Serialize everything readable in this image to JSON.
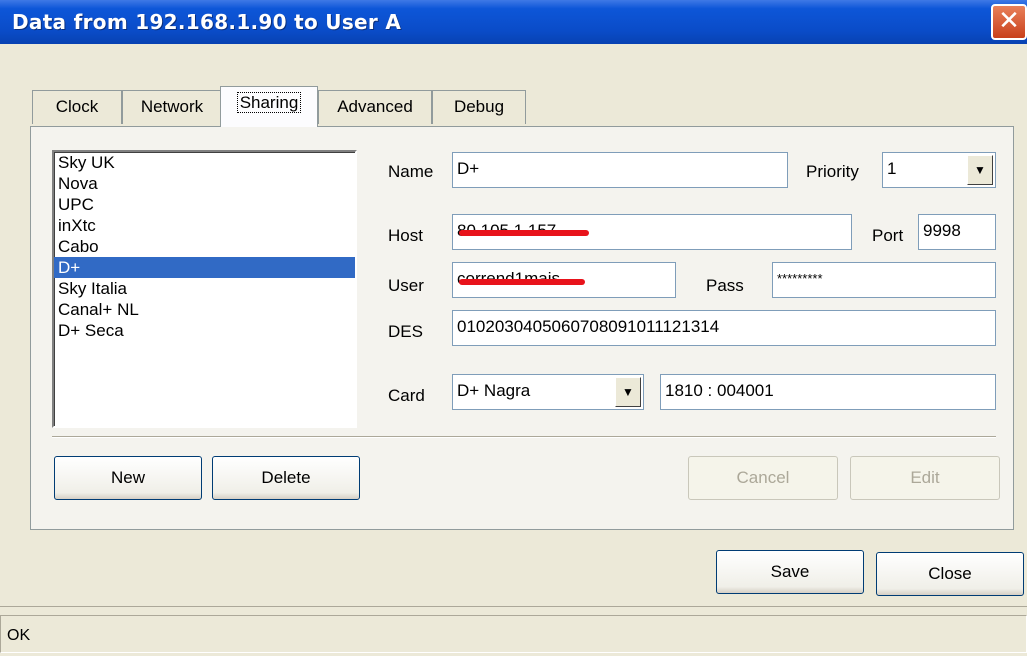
{
  "window": {
    "title": "Data from 192.168.1.90 to User A",
    "close_glyph": "✕"
  },
  "tabs": [
    {
      "label": "Clock"
    },
    {
      "label": "Network"
    },
    {
      "label": "Sharing"
    },
    {
      "label": "Advanced"
    },
    {
      "label": "Debug"
    }
  ],
  "providers": {
    "items": [
      "Sky UK",
      "Nova",
      "UPC",
      "inXtc",
      "Cabo",
      "D+",
      "Sky Italia",
      "Canal+ NL",
      "D+ Seca"
    ],
    "selected": "D+"
  },
  "form": {
    "name_label": "Name",
    "name_value": "D+",
    "priority_label": "Priority",
    "priority_value": "1",
    "host_label": "Host",
    "host_value": "80.105.1.157",
    "port_label": "Port",
    "port_value": "9998",
    "user_label": "User",
    "user_value": "corrend1mais",
    "pass_label": "Pass",
    "pass_value": "*********",
    "des_label": "DES",
    "des_value": "0102030405060708091011121314",
    "card_label": "Card",
    "card_value": "D+ Nagra",
    "caid_value": "1810 : 004001"
  },
  "buttons": {
    "new": "New",
    "delete": "Delete",
    "cancel": "Cancel",
    "edit": "Edit",
    "save": "Save",
    "close": "Close"
  },
  "status": {
    "text": "OK"
  }
}
